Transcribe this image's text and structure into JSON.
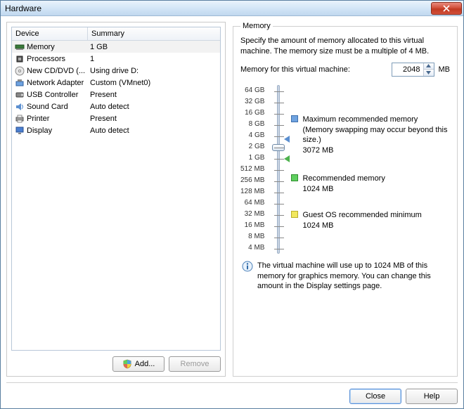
{
  "window": {
    "title": "Hardware",
    "close_button": "Close window"
  },
  "device_table": {
    "headers": {
      "device": "Device",
      "summary": "Summary"
    },
    "rows": [
      {
        "icon": "ram-icon",
        "name": "Memory",
        "summary": "1 GB",
        "selected": true
      },
      {
        "icon": "cpu-icon",
        "name": "Processors",
        "summary": "1",
        "selected": false
      },
      {
        "icon": "cd-icon",
        "name": "New CD/DVD (...",
        "summary": "Using drive D:",
        "selected": false
      },
      {
        "icon": "nic-icon",
        "name": "Network Adapter",
        "summary": "Custom (VMnet0)",
        "selected": false
      },
      {
        "icon": "usb-icon",
        "name": "USB Controller",
        "summary": "Present",
        "selected": false
      },
      {
        "icon": "sound-icon",
        "name": "Sound Card",
        "summary": "Auto detect",
        "selected": false
      },
      {
        "icon": "printer-icon",
        "name": "Printer",
        "summary": "Present",
        "selected": false
      },
      {
        "icon": "display-icon",
        "name": "Display",
        "summary": "Auto detect",
        "selected": false
      }
    ],
    "add_button": "Add...",
    "remove_button": "Remove"
  },
  "memory_panel": {
    "legend": "Memory",
    "description": "Specify the amount of memory allocated to this virtual machine. The memory size must be a multiple of 4 MB.",
    "input_label": "Memory for this virtual machine:",
    "input_value": "2048",
    "unit": "MB",
    "scale": [
      "64 GB",
      "32 GB",
      "16 GB",
      "8 GB",
      "4 GB",
      "2 GB",
      "1 GB",
      "512 MB",
      "256 MB",
      "128 MB",
      "64 MB",
      "32 MB",
      "16 MB",
      "8 MB",
      "4 MB"
    ],
    "max_rec": {
      "title": "Maximum recommended memory",
      "note": "(Memory swapping may occur beyond this size.)",
      "value": "3072 MB"
    },
    "rec": {
      "title": "Recommended memory",
      "value": "1024 MB"
    },
    "guest_min": {
      "title": "Guest OS recommended minimum",
      "value": "1024 MB"
    },
    "info": "The virtual machine will use up to 1024 MB of this memory for graphics memory. You can change this amount in the Display settings page."
  },
  "footer": {
    "close": "Close",
    "help": "Help"
  }
}
